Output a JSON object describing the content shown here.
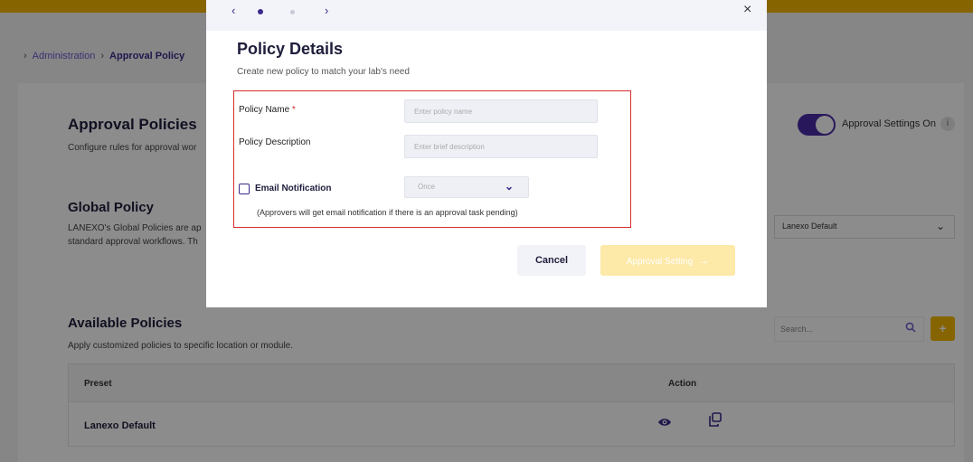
{
  "breadcrumb": {
    "parent": "Administration",
    "current": "Approval Policy"
  },
  "approval_policies": {
    "title": "Approval Policies",
    "subtitle": "Configure rules for approval wor",
    "toggle_label": "Approval Settings On",
    "toggle_on": true,
    "info_glyph": "i"
  },
  "global_policy": {
    "title": "Global Policy",
    "desc_line1": "LANEXO's Global Policies are ap",
    "desc_line2": "standard approval workflows. Th",
    "selected": "Lanexo Default"
  },
  "available_policies": {
    "title": "Available Policies",
    "subtitle": "Apply customized policies to specific location or module.",
    "search_placeholder": "Search...",
    "add_label": "+",
    "columns": {
      "preset": "Preset",
      "action": "Action"
    },
    "rows": [
      {
        "preset": "Lanexo Default"
      }
    ]
  },
  "modal": {
    "nav_prev": "‹",
    "nav_next": "›",
    "close": "×",
    "title": "Policy Details",
    "subtitle": "Create new policy to match your lab's need",
    "policy_name_label": "Policy Name",
    "required_mark": "*",
    "policy_name_placeholder": "Enter policy name",
    "policy_desc_label": "Policy Description",
    "policy_desc_placeholder": "Enter brief description",
    "email_label": "Email Notification",
    "email_checked": false,
    "frequency_value": "Once",
    "hint": "(Approvers will get email notification if there is an approval task pending)",
    "cancel_label": "Cancel",
    "next_label": "Approval Setting",
    "next_arrow": "→"
  },
  "colors": {
    "brand_yellow": "#f5b800",
    "brand_purple": "#3b2a8a",
    "toggle_purple": "#4b2aa8",
    "highlight_red": "#d62d2d",
    "disabled_yellow": "#fde9a8"
  },
  "icons": [
    "chevron-left-icon",
    "chevron-right-icon",
    "close-icon",
    "chevron-down-icon",
    "search-icon",
    "plus-icon",
    "eye-icon",
    "copy-icon",
    "info-icon"
  ]
}
